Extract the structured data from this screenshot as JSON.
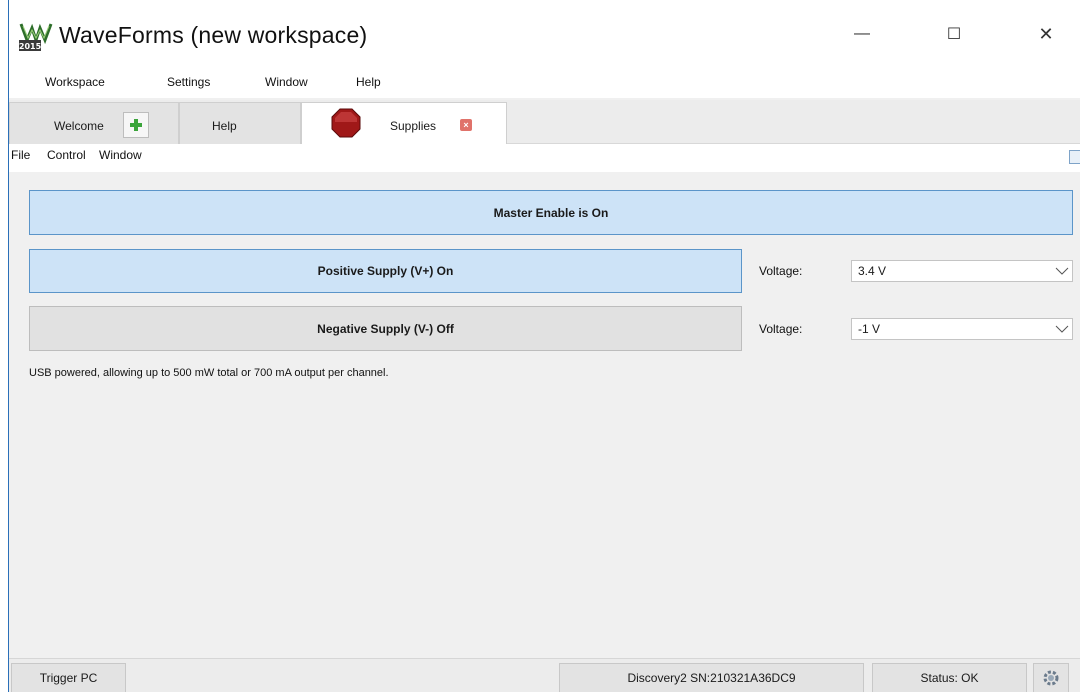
{
  "app": {
    "title": "WaveForms  (new workspace)",
    "logo_text": "2015",
    "window_controls": {
      "minimize": "—",
      "maximize": "☐",
      "close": "✕"
    }
  },
  "menubar": {
    "items": [
      {
        "label": "Workspace"
      },
      {
        "label": "Settings"
      },
      {
        "label": "Window"
      },
      {
        "label": "Help"
      }
    ]
  },
  "tabs": [
    {
      "label": "Welcome"
    },
    {
      "label": "Help"
    },
    {
      "label": "Supplies",
      "active": true
    }
  ],
  "icons": {
    "add": "add-icon",
    "stop": "stop-icon",
    "close_tab": "close-icon",
    "gear": "gear-icon",
    "dropdown": "chevron-down-icon"
  },
  "submenu": {
    "items": [
      {
        "label": "File"
      },
      {
        "label": "Control"
      },
      {
        "label": "Window"
      }
    ]
  },
  "main": {
    "master_enable": "Master Enable is On",
    "positive_supply": "Positive Supply (V+) On",
    "negative_supply": "Negative Supply (V-) Off",
    "voltage_label": "Voltage:",
    "positive_voltage": "3.4 V",
    "negative_voltage": "-1 V",
    "usb_note": "USB powered, allowing up to 500 mW total or 700 mA output per channel."
  },
  "statusbar": {
    "trigger": "Trigger PC",
    "device": "Discovery2 SN:210321A36DC9",
    "status": "Status: OK"
  },
  "colors": {
    "on_fill": "#cde3f7",
    "on_border": "#5b95c9",
    "off_fill": "#e1e1e1",
    "stop_red": "#a01818",
    "add_green": "#3aa43a"
  }
}
